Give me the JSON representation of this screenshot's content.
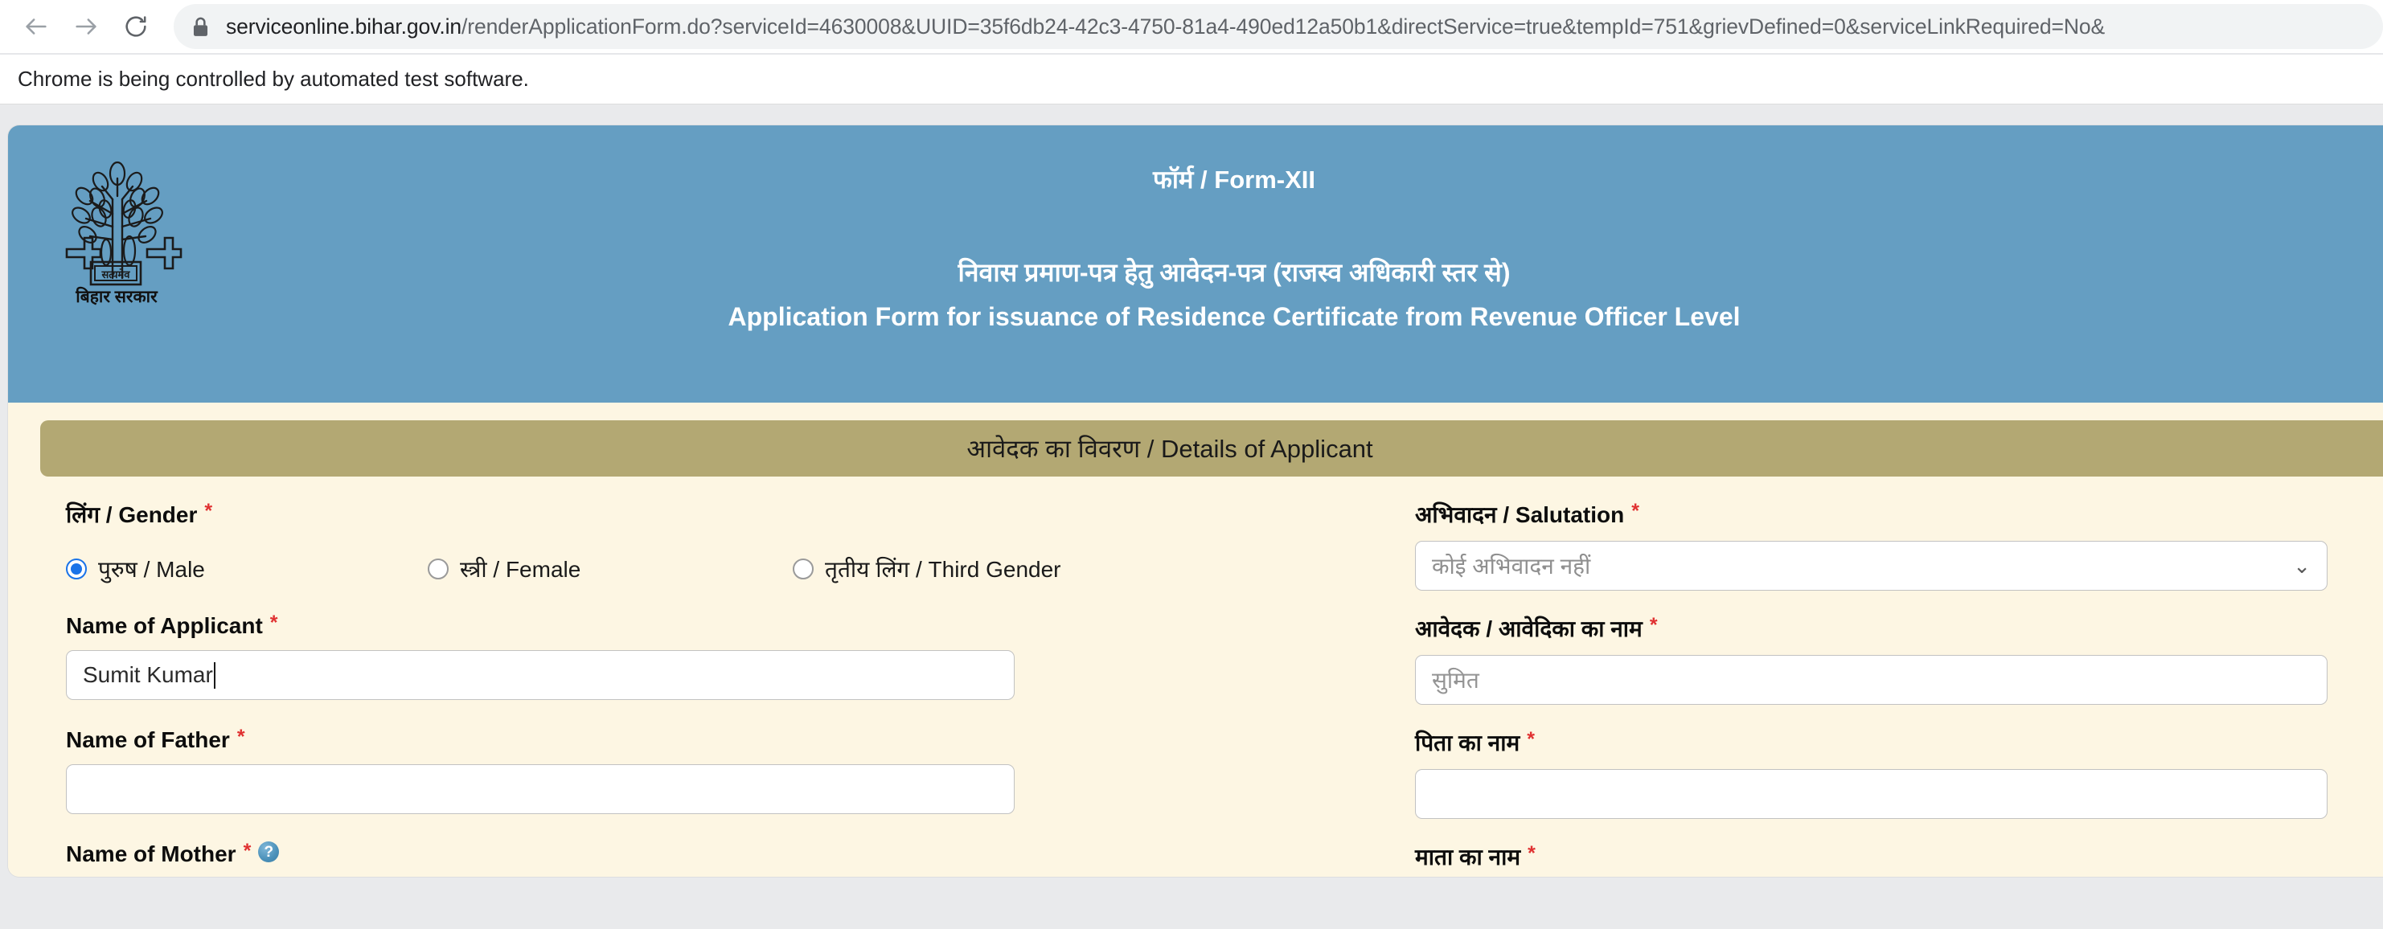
{
  "browser": {
    "back_label": "Back",
    "forward_label": "Forward",
    "reload_label": "Reload",
    "url_host": "serviceonline.bihar.gov.in",
    "url_path": "/renderApplicationForm.do?serviceId=4630008&UUID=35f6db24-42c3-4750-81a4-490ed12a50b1&directService=true&tempId=751&grievDefined=0&serviceLinkRequired=No&",
    "infobar_message": "Chrome is being controlled by automated test software."
  },
  "header": {
    "emblem_caption": "बिहार सरकार",
    "emblem_inner_text": "सत्यमेव",
    "form_number": "फॉर्म / Form-XII",
    "title_hi": "निवास प्रमाण-पत्र हेतु आवेदन-पत्र (राजस्व अधिकारी स्तर से)",
    "title_en": "Application Form for issuance of  Residence Certificate from Revenue Officer Level",
    "banner_color": "#659ec2"
  },
  "section": {
    "title": "आवेदक का विवरण / Details of Applicant",
    "bar_color": "#b3a873",
    "panel_color": "#fdf6e3"
  },
  "form": {
    "required_marker": "*",
    "help_glyph": "?",
    "gender": {
      "label": "लिंग / Gender",
      "options": [
        {
          "label": "पुरुष / Male",
          "selected": true
        },
        {
          "label": "स्त्री / Female",
          "selected": false
        },
        {
          "label": "तृतीय लिंग / Third Gender",
          "selected": false
        }
      ]
    },
    "salutation": {
      "label": "अभिवादन / Salutation",
      "selected": "कोई अभिवादन नहीं",
      "chevron": "⌄"
    },
    "name_applicant_en": {
      "label": "Name of Applicant",
      "value": "Sumit Kumar"
    },
    "name_applicant_hi": {
      "label": "आवेदक / आवेदिका का नाम",
      "placeholder": "सुमित",
      "value": ""
    },
    "name_father_en": {
      "label": "Name of Father",
      "value": ""
    },
    "name_father_hi": {
      "label": "पिता का नाम",
      "value": ""
    },
    "name_mother_en": {
      "label": "Name of Mother",
      "value": ""
    },
    "name_mother_hi": {
      "label": "माता का नाम",
      "value": ""
    }
  }
}
